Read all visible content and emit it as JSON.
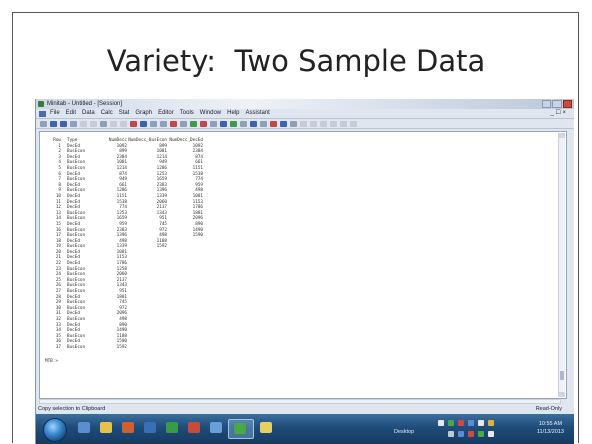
{
  "slide": {
    "title": "Variety:  Two Sample Data"
  },
  "window": {
    "title": "Minitab - Untitled - [Session]",
    "menu": [
      "File",
      "Edit",
      "Data",
      "Calc",
      "Stat",
      "Graph",
      "Editor",
      "Tools",
      "Window",
      "Help",
      "Assistant"
    ],
    "menu_right": "_ ☐ ×"
  },
  "session": {
    "headers": [
      "Row",
      "Type",
      "NumDecc",
      "NumDecc_BusEcon",
      "NumDecc_DecEd"
    ],
    "rows": [
      [
        "1",
        "DecEd",
        "1092",
        "899",
        "1092"
      ],
      [
        "2",
        "BusEcon",
        "899",
        "1081",
        "2384"
      ],
      [
        "3",
        "DecEd",
        "2384",
        "1214",
        "874"
      ],
      [
        "4",
        "BusEcon",
        "1081",
        "949",
        "661"
      ],
      [
        "5",
        "BusEcon",
        "1214",
        "1286",
        "1151"
      ],
      [
        "6",
        "DecEd",
        "874",
        "1253",
        "1538"
      ],
      [
        "7",
        "BusEcon",
        "949",
        "1659",
        "774"
      ],
      [
        "8",
        "DecEd",
        "661",
        "2383",
        "959"
      ],
      [
        "9",
        "BusEcon",
        "1286",
        "1396",
        "498"
      ],
      [
        "10",
        "DecEd",
        "1151",
        "1339",
        "1081"
      ],
      [
        "11",
        "DecEd",
        "1538",
        "2060",
        "1153"
      ],
      [
        "12",
        "DecEd",
        "774",
        "2137",
        "1786"
      ],
      [
        "13",
        "BusEcon",
        "1253",
        "1343",
        "1881"
      ],
      [
        "14",
        "BusEcon",
        "1659",
        "951",
        "2096"
      ],
      [
        "15",
        "DecEd",
        "959",
        "745",
        "890"
      ],
      [
        "16",
        "BusEcon",
        "2383",
        "972",
        "1490"
      ],
      [
        "17",
        "BusEcon",
        "1396",
        "498",
        "1590"
      ],
      [
        "18",
        "DecEd",
        "498",
        "1188",
        ""
      ],
      [
        "19",
        "BusEcon",
        "1339",
        "1592",
        ""
      ],
      [
        "20",
        "DecEd",
        "1081",
        "",
        ""
      ],
      [
        "21",
        "DecEd",
        "1153",
        "",
        ""
      ],
      [
        "22",
        "DecEd",
        "1786",
        "",
        ""
      ],
      [
        "23",
        "BusEcon",
        "1258",
        "",
        ""
      ],
      [
        "24",
        "BusEcon",
        "2060",
        "",
        ""
      ],
      [
        "25",
        "BusEcon",
        "2137",
        "",
        ""
      ],
      [
        "26",
        "BusEcon",
        "1343",
        "",
        ""
      ],
      [
        "27",
        "BusEcon",
        "951",
        "",
        ""
      ],
      [
        "28",
        "DecEd",
        "1881",
        "",
        ""
      ],
      [
        "29",
        "BusEcon",
        "745",
        "",
        ""
      ],
      [
        "30",
        "BusEcon",
        "972",
        "",
        ""
      ],
      [
        "31",
        "DecEd",
        "2096",
        "",
        ""
      ],
      [
        "32",
        "BusEcon",
        "498",
        "",
        ""
      ],
      [
        "33",
        "DecEd",
        "890",
        "",
        ""
      ],
      [
        "34",
        "DecEd",
        "1490",
        "",
        ""
      ],
      [
        "35",
        "BusEcon",
        "1188",
        "",
        ""
      ],
      [
        "36",
        "DecEd",
        "1590",
        "",
        ""
      ],
      [
        "37",
        "BusEcon",
        "1592",
        "",
        ""
      ]
    ],
    "prompt": "MTB >"
  },
  "status": {
    "left": "Copy selection to Clipboard",
    "right": "Read-Only"
  },
  "taskbar": {
    "desktop_label": "Desktop",
    "time": "10:55 AM",
    "date": "11/13/2013"
  }
}
